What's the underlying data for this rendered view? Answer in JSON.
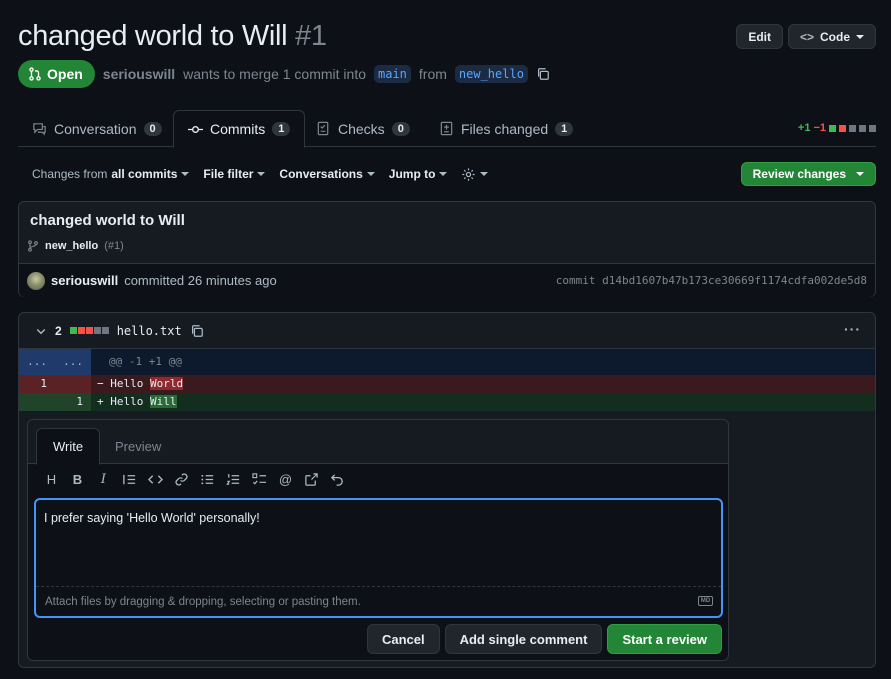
{
  "pr": {
    "title": "changed world to Will",
    "number": "#1",
    "state": "Open",
    "author": "seriouswill",
    "merge_text": "wants to merge 1 commit into",
    "base_branch": "main",
    "from_text": "from",
    "head_branch": "new_hello",
    "edit_label": "Edit",
    "code_label": "Code"
  },
  "tabs": [
    {
      "label": "Conversation",
      "count": "0"
    },
    {
      "label": "Commits",
      "count": "1"
    },
    {
      "label": "Checks",
      "count": "0"
    },
    {
      "label": "Files changed",
      "count": "1"
    }
  ],
  "diffstat": {
    "additions": "+1",
    "deletions": "−1"
  },
  "toolbar": {
    "changes_prefix": "Changes from",
    "changes_value": "all commits",
    "file_filter": "File filter",
    "conversations": "Conversations",
    "jump_to": "Jump to",
    "review_changes": "Review changes"
  },
  "commit": {
    "title": "changed world to Will",
    "branch": "new_hello",
    "ref": "(#1)",
    "author": "seriouswill",
    "action": "committed 26 minutes ago",
    "sha": "commit d14bd1607b47b173ce30669f1174cdfa002de5d8"
  },
  "file": {
    "changes": "2",
    "name": "hello.txt",
    "hunk_left": "...",
    "hunk_right": "...",
    "hunk": "@@ -1 +1 @@",
    "removed": {
      "line": "1",
      "sign": "−",
      "prefix": "Hello ",
      "highlight": "World"
    },
    "added": {
      "line": "1",
      "sign": "+",
      "prefix": "Hello ",
      "highlight": "Will"
    }
  },
  "comment": {
    "write_tab": "Write",
    "preview_tab": "Preview",
    "text": "I prefer saying 'Hello World' personally!",
    "attach_hint": "Attach files by dragging & dropping, selecting or pasting them.",
    "markdown_badge": "MD",
    "cancel": "Cancel",
    "add_single": "Add single comment",
    "start_review": "Start a review"
  }
}
